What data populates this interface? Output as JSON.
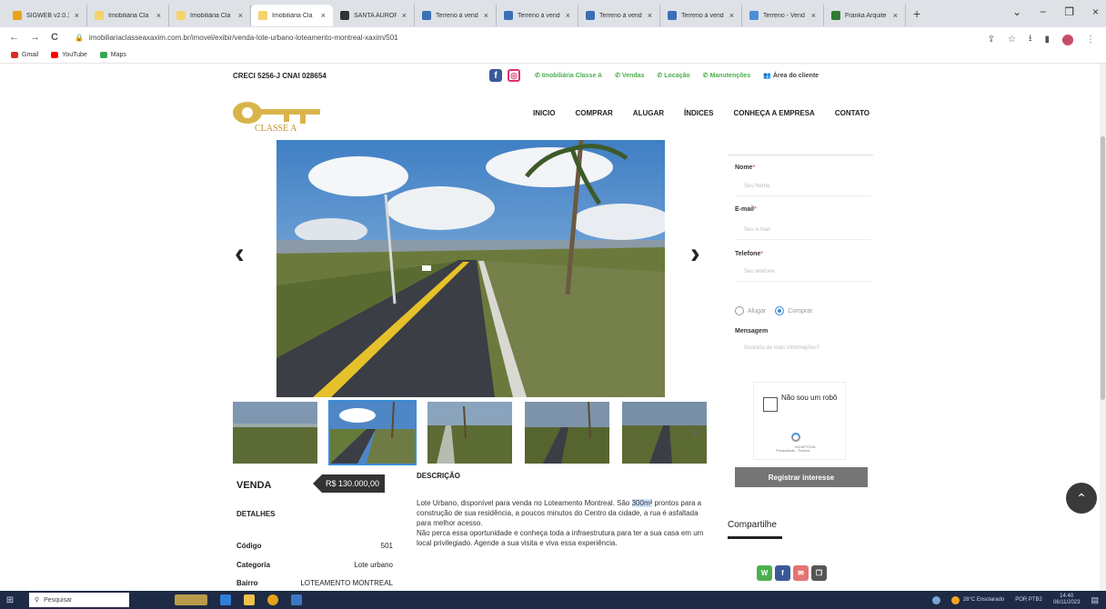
{
  "browser": {
    "tabs": [
      {
        "label": "SIGWEB v2.0.1",
        "color": "#e8a317"
      },
      {
        "label": "Imobiliária Cla",
        "color": "#f3d36b"
      },
      {
        "label": "Imobiliária Cla",
        "color": "#f3d36b"
      },
      {
        "label": "Imobiliária Cla",
        "color": "#f3d36b",
        "active": true
      },
      {
        "label": "SANTA AURORA",
        "color": "#333333"
      },
      {
        "label": "Terreno à vend",
        "color": "#3b6fb6"
      },
      {
        "label": "Terreno à vend",
        "color": "#3b6fb6"
      },
      {
        "label": "Terreno à vend",
        "color": "#3b6fb6"
      },
      {
        "label": "Terreno à vend",
        "color": "#3b6fb6"
      },
      {
        "label": "Terreno - Vend",
        "color": "#4a8ed6"
      },
      {
        "label": "Franka Arquite",
        "color": "#2e7d32"
      }
    ],
    "tab_close": "×",
    "new_tab": "+",
    "url": "imobiliariaclasseaxaxim.com.br/imovel/exibir/venda-lote-urbano-loteamento-montreal-xaxim/501",
    "bookmarks": [
      {
        "label": "Gmail",
        "color": "#d93025"
      },
      {
        "label": "YouTube",
        "color": "#ff0000"
      },
      {
        "label": "Maps",
        "color": "#34a853"
      }
    ],
    "nav": {
      "back": "←",
      "forward": "→",
      "reload": "C",
      "lock": "🔒"
    },
    "window_controls": {
      "chevron": "⌄",
      "minimize": "−",
      "restore": "❐",
      "close": "×"
    },
    "toolbar_icons": {
      "share": "⇪",
      "star": "☆",
      "download": "⭳",
      "sidepanel": "▮",
      "menu": "⋮"
    }
  },
  "site": {
    "creci": "CRECI 5256-J   CNAI 028654",
    "social": {
      "facebook": "f",
      "instagram": "◎"
    },
    "top_links": [
      "Imobiliária Classe A",
      "Vendas",
      "Locação",
      "Manutenções"
    ],
    "client_area": "Área do cliente",
    "menu": [
      "INICIO",
      "COMPRAR",
      "ALUGAR",
      "ÍNDICES",
      "CONHEÇA A EMPRESA",
      "CONTATO"
    ],
    "logo_text": "CLASSE A",
    "arrows": {
      "prev": "‹",
      "next": "›",
      "thumb_next": "›"
    },
    "listing": {
      "type": "VENDA",
      "price": "R$ 130.000,00",
      "details_title": "DETALHES",
      "details": [
        {
          "key": "Código",
          "value": "501"
        },
        {
          "key": "Categoria",
          "value": "Lote urbano"
        },
        {
          "key": "Bairro",
          "value": "LOTEAMENTO MONTREAL"
        }
      ],
      "description_title": "DESCRIÇÃO",
      "description_1a": "Lote Urbano, disponível para venda no Loteamento Montreal. São ",
      "description_highlight": "300m²",
      "description_1b": " prontos para a construção de sua residência, a poucos minutos do Centro da cidade, a rua é asfaltada para melhor acesso.",
      "description_2": "Não perca essa oportunidade e conheça toda a infraestrutura para ter a sua casa em um local privilegiado. Agende a sua visita e viva essa experiência."
    },
    "form": {
      "required": "*",
      "name_label": "Nome",
      "name_placeholder": "Seu Nome",
      "email_label": "E-mail",
      "email_placeholder": "Seu e-mail",
      "phone_label": "Telefone",
      "phone_placeholder": "Seu telefone",
      "radio_rent": "Alugar",
      "radio_buy": "Comprar",
      "message_label": "Mensagem",
      "message_placeholder": "Gostaria de mais informações?",
      "captcha_text": "Não sou um robô",
      "captcha_brand": "reCAPTCHA",
      "captcha_links": "Privacidade - Termos",
      "submit": "Registrar interesse"
    },
    "share": {
      "title": "Compartilhe",
      "buttons": [
        "W",
        "f",
        "✉",
        "❐"
      ]
    },
    "totop": "⌃"
  },
  "taskbar": {
    "start": "⊞",
    "search": "Pesquisar",
    "weather": "28°C  Ensolarado",
    "lang": "POR PTB2",
    "time": "14:40",
    "date": "06/11/2023"
  }
}
